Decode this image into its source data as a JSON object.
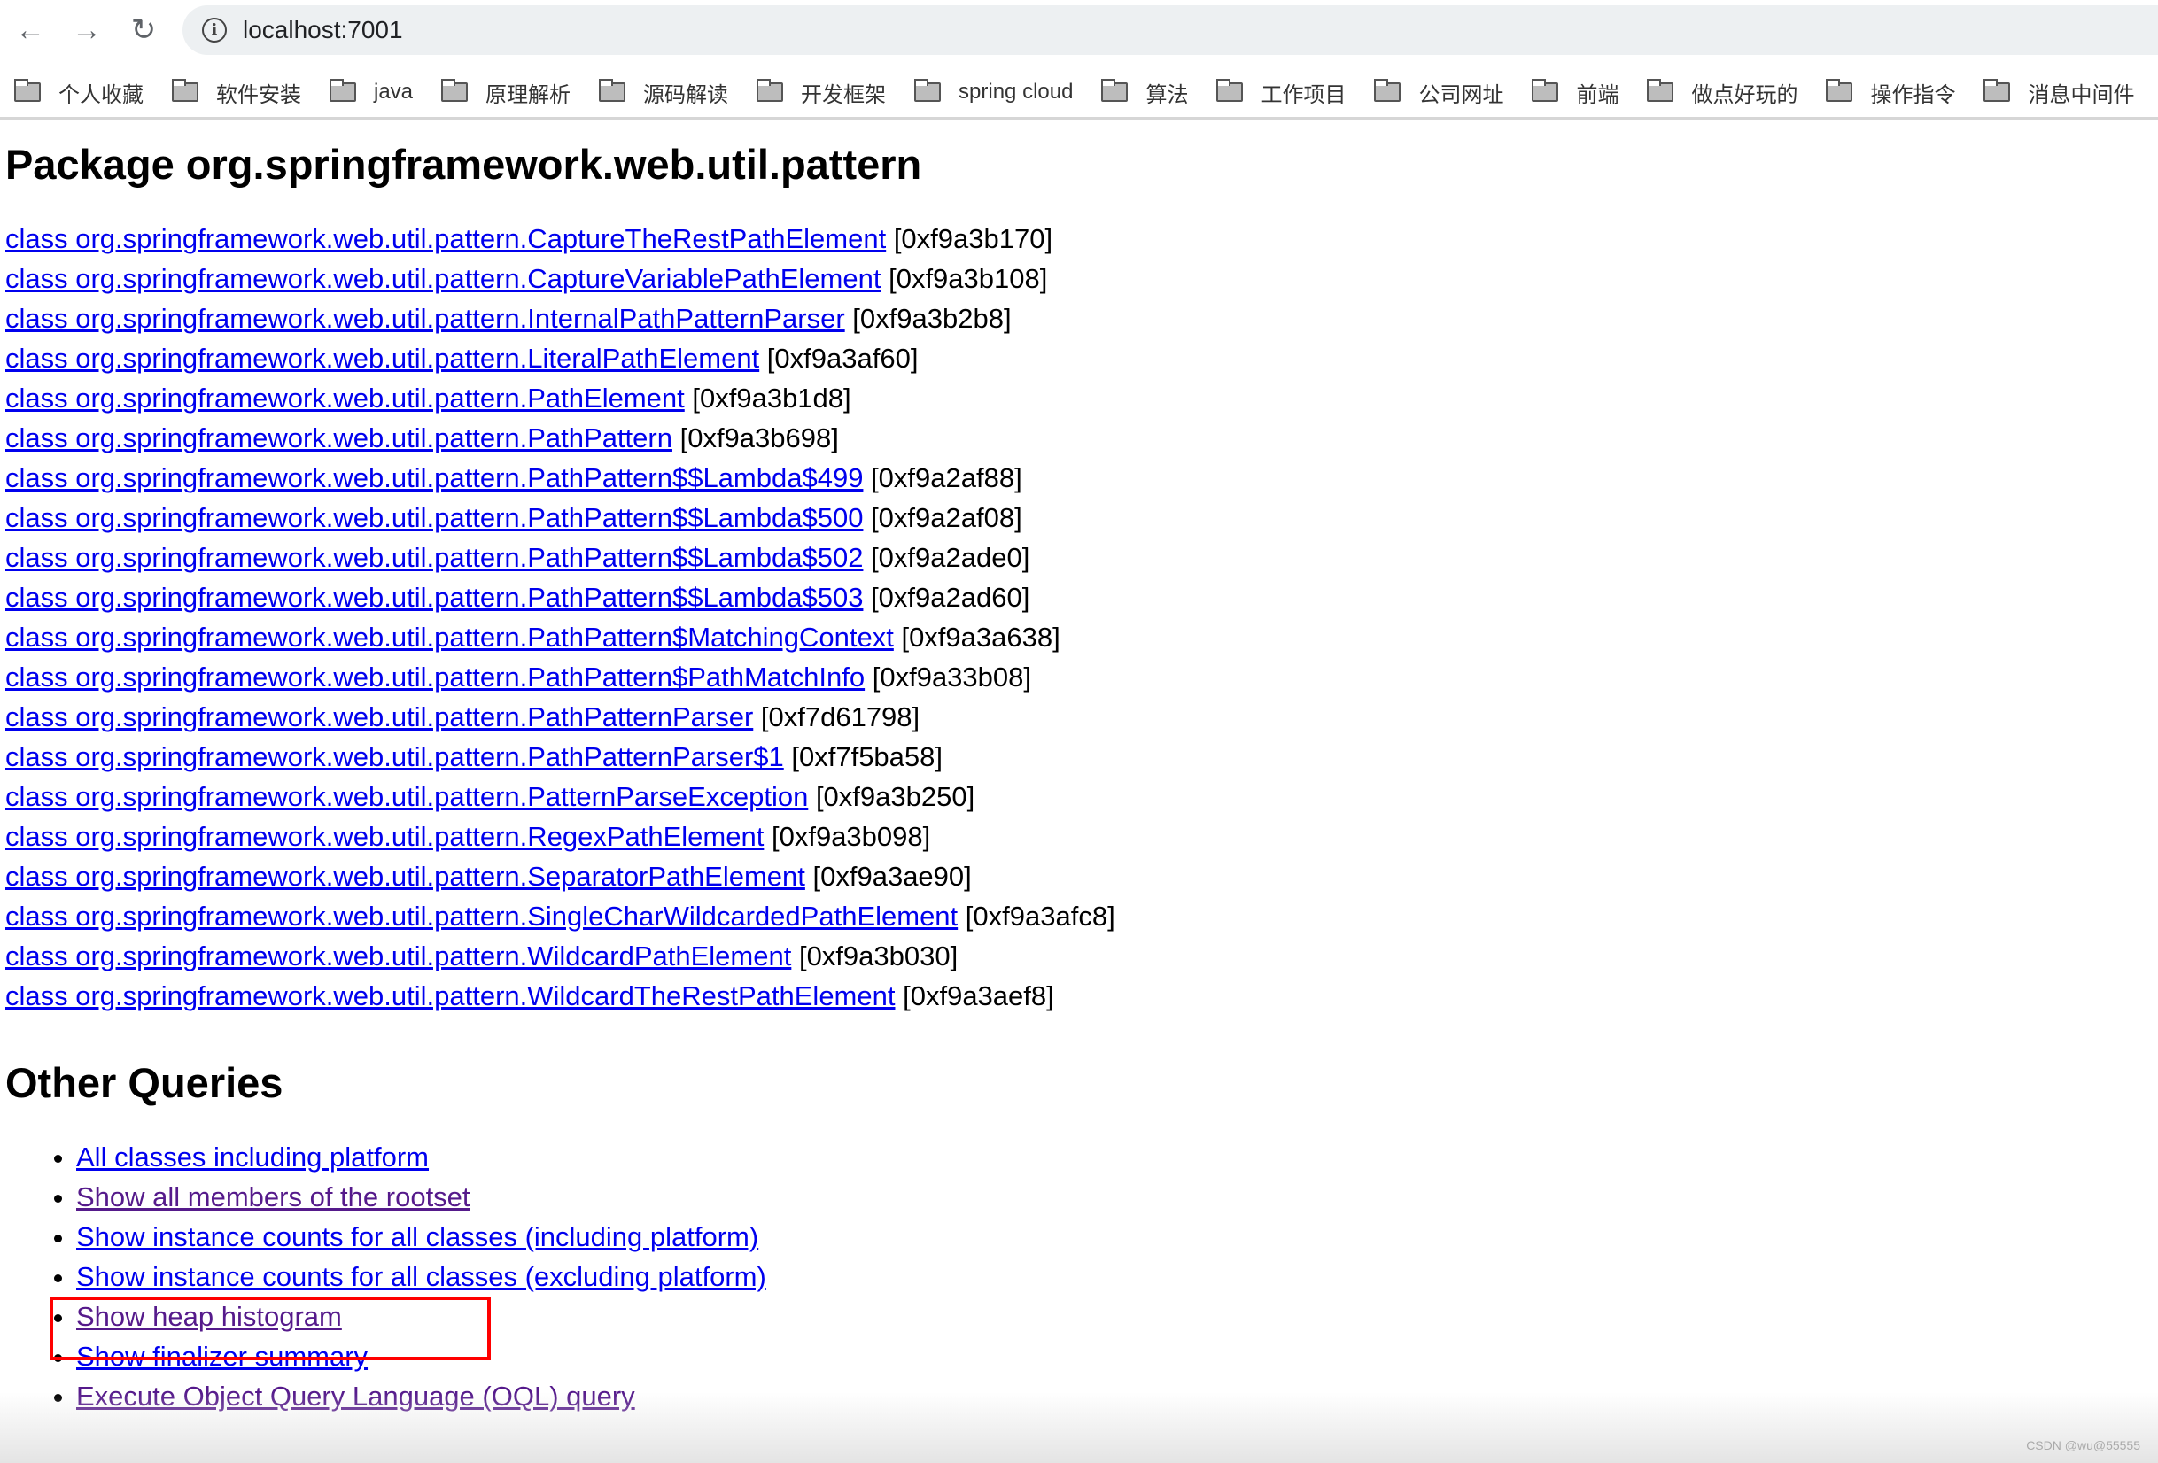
{
  "browser": {
    "url": "localhost:7001",
    "bookmarks": [
      "个人收藏",
      "软件安装",
      "java",
      "原理解析",
      "源码解读",
      "开发框架",
      "spring cloud",
      "算法",
      "工作项目",
      "公司网址",
      "前端",
      "做点好玩的",
      "操作指令",
      "消息中间件"
    ]
  },
  "page": {
    "title": "Package org.springframework.web.util.pattern",
    "classes": [
      {
        "name": "class org.springframework.web.util.pattern.CaptureTheRestPathElement",
        "addr": "[0xf9a3b170]"
      },
      {
        "name": "class org.springframework.web.util.pattern.CaptureVariablePathElement",
        "addr": "[0xf9a3b108]"
      },
      {
        "name": "class org.springframework.web.util.pattern.InternalPathPatternParser",
        "addr": "[0xf9a3b2b8]"
      },
      {
        "name": "class org.springframework.web.util.pattern.LiteralPathElement",
        "addr": "[0xf9a3af60]"
      },
      {
        "name": "class org.springframework.web.util.pattern.PathElement",
        "addr": "[0xf9a3b1d8]"
      },
      {
        "name": "class org.springframework.web.util.pattern.PathPattern",
        "addr": "[0xf9a3b698]"
      },
      {
        "name": "class org.springframework.web.util.pattern.PathPattern$$Lambda$499",
        "addr": "[0xf9a2af88]"
      },
      {
        "name": "class org.springframework.web.util.pattern.PathPattern$$Lambda$500",
        "addr": "[0xf9a2af08]"
      },
      {
        "name": "class org.springframework.web.util.pattern.PathPattern$$Lambda$502",
        "addr": "[0xf9a2ade0]"
      },
      {
        "name": "class org.springframework.web.util.pattern.PathPattern$$Lambda$503",
        "addr": "[0xf9a2ad60]"
      },
      {
        "name": "class org.springframework.web.util.pattern.PathPattern$MatchingContext",
        "addr": "[0xf9a3a638]"
      },
      {
        "name": "class org.springframework.web.util.pattern.PathPattern$PathMatchInfo",
        "addr": "[0xf9a33b08]"
      },
      {
        "name": "class org.springframework.web.util.pattern.PathPatternParser",
        "addr": "[0xf7d61798]"
      },
      {
        "name": "class org.springframework.web.util.pattern.PathPatternParser$1",
        "addr": "[0xf7f5ba58]"
      },
      {
        "name": "class org.springframework.web.util.pattern.PatternParseException",
        "addr": "[0xf9a3b250]"
      },
      {
        "name": "class org.springframework.web.util.pattern.RegexPathElement",
        "addr": "[0xf9a3b098]"
      },
      {
        "name": "class org.springframework.web.util.pattern.SeparatorPathElement",
        "addr": "[0xf9a3ae90]"
      },
      {
        "name": "class org.springframework.web.util.pattern.SingleCharWildcardedPathElement",
        "addr": "[0xf9a3afc8]"
      },
      {
        "name": "class org.springframework.web.util.pattern.WildcardPathElement",
        "addr": "[0xf9a3b030]"
      },
      {
        "name": "class org.springframework.web.util.pattern.WildcardTheRestPathElement",
        "addr": "[0xf9a3aef8]"
      }
    ],
    "other_title": "Other Queries",
    "queries": [
      {
        "label": "All classes including platform",
        "visited": false
      },
      {
        "label": "Show all members of the rootset",
        "visited": true
      },
      {
        "label": "Show instance counts for all classes (including platform)",
        "visited": false
      },
      {
        "label": "Show instance counts for all classes (excluding platform)",
        "visited": false
      },
      {
        "label": "Show heap histogram",
        "visited": true,
        "highlighted": true
      },
      {
        "label": "Show finalizer summary",
        "visited": false
      },
      {
        "label": "Execute Object Query Language (OQL) query",
        "visited": true
      }
    ]
  },
  "watermark": "CSDN @wu@55555",
  "colors": {
    "link": "#0000ee",
    "visited": "#551a8b",
    "highlight_box": "#ff0000"
  }
}
